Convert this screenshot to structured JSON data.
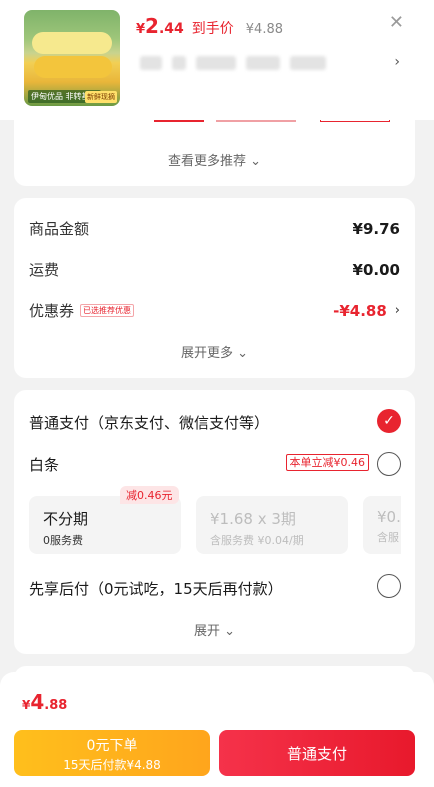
{
  "product": {
    "price_currency": "¥",
    "price_int": "2",
    "price_dec": ".44",
    "price_tag": "到手价",
    "original_price": "¥4.88",
    "thumb_caption": "伊甸优品 非转基因",
    "thumb_badge": "新鲜现摘"
  },
  "recommend": {
    "more_label": "查看更多推荐 ⌄"
  },
  "summary": {
    "goods_label": "商品金额",
    "goods_value": "¥9.76",
    "shipping_label": "运费",
    "shipping_value": "¥0.00",
    "coupon_label": "优惠券",
    "coupon_badge": "已选推荐优惠",
    "coupon_value": "-¥4.88",
    "expand_label": "展开更多 ⌄"
  },
  "payment": {
    "normal_label": "普通支付（京东支付、微信支付等）",
    "baitiao_label": "白条",
    "baitiao_discount": "本单立减¥0.46",
    "plan_badge": "减0.46元",
    "plans": [
      {
        "a": "不分期",
        "b": "0服务费"
      },
      {
        "a": "¥1.68 x 3期",
        "b": "含服务费 ¥0.04/期"
      },
      {
        "a": "¥0.",
        "b": "含服"
      }
    ],
    "bnpl_label": "先享后付（0元试吃，15天后再付款）",
    "expand_label": "展开 ⌄"
  },
  "footer": {
    "total_currency": "¥",
    "total_int": "4",
    "total_dec": ".88",
    "later_line1": "0元下单",
    "later_line2": "15天后付款¥4.88",
    "pay_label": "普通支付"
  },
  "icons": {
    "close": "✕",
    "chevron": "›",
    "check": "✓"
  },
  "colors": {
    "accent": "#e8242f",
    "later_button": "#ffa51c"
  }
}
